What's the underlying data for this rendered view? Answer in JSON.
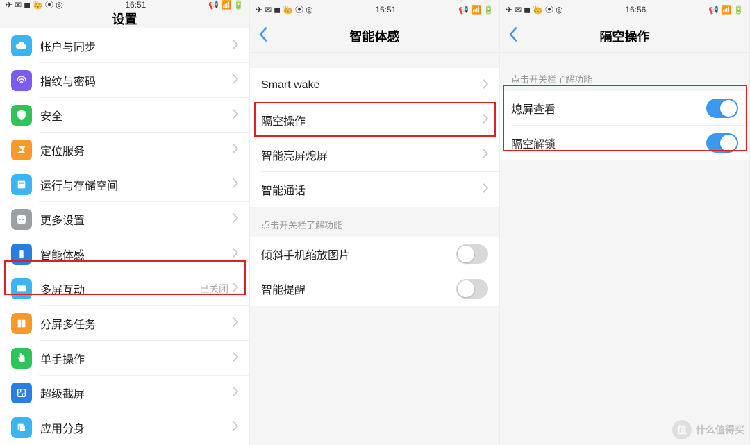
{
  "status": {
    "time_a": "16:51",
    "time_b": "16:51",
    "time_c": "16:56",
    "icons_left": [
      "✈",
      "✉",
      "◼",
      "👑",
      "⦿",
      "◎"
    ],
    "icons_right": [
      "📢",
      "📶",
      "🔋"
    ]
  },
  "panel1": {
    "title": "设置",
    "group1": [
      {
        "label": "帐户与同步",
        "icon": "cloud",
        "color": "#3bb4f2"
      },
      {
        "label": "指纹与密码",
        "icon": "finger",
        "color": "#7a5cf0"
      },
      {
        "label": "安全",
        "icon": "shield",
        "color": "#2fc45a"
      },
      {
        "label": "定位服务",
        "icon": "location",
        "color": "#f79a2a"
      },
      {
        "label": "运行与存储空间",
        "icon": "storage",
        "color": "#3bb4f2"
      },
      {
        "label": "更多设置",
        "icon": "more",
        "color": "#9aa0a6"
      }
    ],
    "group2": [
      {
        "label": "智能体感",
        "icon": "motion",
        "color": "#2a7de1"
      },
      {
        "label": "多屏互动",
        "icon": "cast",
        "color": "#3bb4f2",
        "meta": "已关闭"
      },
      {
        "label": "分屏多任务",
        "icon": "split",
        "color": "#f79a2a"
      },
      {
        "label": "单手操作",
        "icon": "onehand",
        "color": "#2fc45a"
      },
      {
        "label": "超级截屏",
        "icon": "screenshot",
        "color": "#2a7de1"
      },
      {
        "label": "应用分身",
        "icon": "clone",
        "color": "#3bb4f2"
      }
    ]
  },
  "panel2": {
    "title": "智能体感",
    "group1": [
      {
        "label": "Smart wake"
      },
      {
        "label": "隔空操作"
      },
      {
        "label": "智能亮屏熄屏"
      },
      {
        "label": "智能通话"
      }
    ],
    "section_title": "点击开关栏了解功能",
    "group2": [
      {
        "label": "倾斜手机缩放图片",
        "on": false
      },
      {
        "label": "智能提醒",
        "on": false
      }
    ]
  },
  "panel3": {
    "title": "隔空操作",
    "section_title": "点击开关栏了解功能",
    "items": [
      {
        "label": "熄屏查看",
        "on": true
      },
      {
        "label": "隔空解锁",
        "on": true
      }
    ]
  },
  "watermark": {
    "badge": "值",
    "text": "什么值得买"
  }
}
